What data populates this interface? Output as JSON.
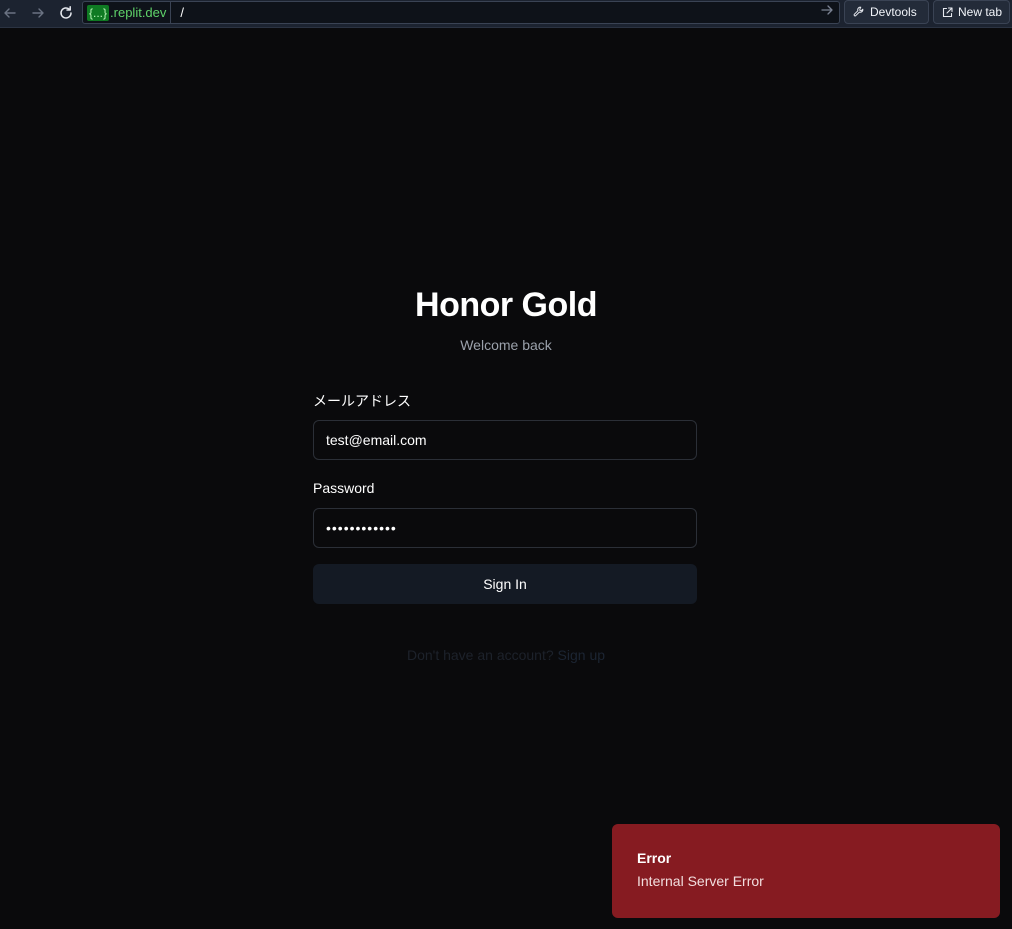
{
  "browser": {
    "domain_badge": "{...}",
    "domain_suffix": ".replit.dev",
    "path": "/",
    "devtools_label": "Devtools",
    "new_tab_label": "New tab",
    "icons": {
      "back": "arrow-left-icon",
      "forward": "arrow-right-icon",
      "reload": "reload-icon",
      "go": "arrow-right-icon",
      "devtools": "wrench-icon",
      "new_tab": "external-link-icon"
    }
  },
  "login": {
    "title": "Honor Gold",
    "subtitle": "Welcome back",
    "email_label": "メールアドレス",
    "email_value": "test@email.com",
    "password_label": "Password",
    "password_value": "••••••••••••",
    "sign_in_label": "Sign In",
    "signup_prompt": "Don't have an account?",
    "signup_link": "Sign up"
  },
  "toast": {
    "title": "Error",
    "message": "Internal Server Error"
  },
  "colors": {
    "page_background": "#0a0a0c",
    "toast_background": "#861b21",
    "domain_text": "#5fd36a"
  }
}
